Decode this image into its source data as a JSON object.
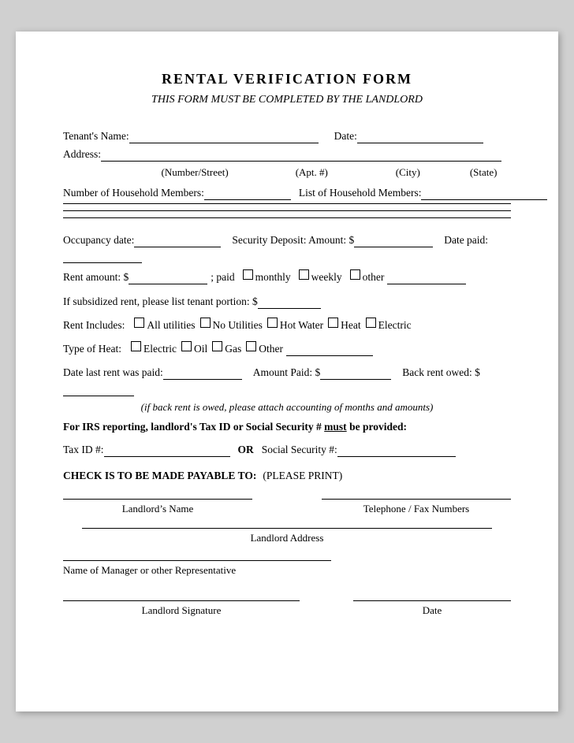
{
  "title": "RENTAL VERIFICATION FORM",
  "subtitle": "THIS FORM MUST BE COMPLETED BY THE LANDLORD",
  "fields": {
    "tenants_name_label": "Tenant's Name:",
    "date_label": "Date:",
    "address_label": "Address:",
    "number_street_label": "(Number/Street)",
    "apt_label": "(Apt. #)",
    "city_label": "(City)",
    "state_label": "(State)",
    "household_members_label": "Number of Household Members:",
    "list_household_label": "List of Household Members:",
    "occupancy_date_label": "Occupancy date:",
    "security_deposit_label": "Security Deposit: Amount: $",
    "date_paid_label": "Date paid:",
    "rent_amount_label": "Rent amount: $",
    "paid_label": "; paid",
    "monthly_label": "monthly",
    "weekly_label": "weekly",
    "other_label": "other",
    "subsidized_label": "If subsidized rent, please list tenant portion: $",
    "rent_includes_label": "Rent Includes:",
    "all_utilities_label": "All utilities",
    "no_utilities_label": "No Utilities",
    "hot_water_label": "Hot Water",
    "heat_label": "Heat",
    "electric_label": "Electric",
    "type_of_heat_label": "Type of Heat:",
    "electric_heat_label": "Electric",
    "oil_label": "Oil",
    "gas_label": "Gas",
    "other_heat_label": "Other",
    "date_last_rent_label": "Date last rent was paid:",
    "amount_paid_label": "Amount Paid: $",
    "back_rent_label": "Back rent owed: $",
    "back_rent_note": "(if back rent is owed, please attach accounting of months and amounts)",
    "irs_section_label": "For IRS reporting, landlord’s Tax ID or Social Security # must be provided:",
    "irs_must_label": "must",
    "tax_id_label": "Tax ID #:",
    "or_label": "OR",
    "social_security_label": "Social Security #:",
    "check_payable_label": "CHECK IS TO BE MADE PAYABLE TO:",
    "please_print_label": "(PLEASE PRINT)",
    "landlords_name_sig_label": "Landlord’s Name",
    "telephone_fax_label": "Telephone / Fax Numbers",
    "landlord_address_label": "Landlord Address",
    "manager_rep_label": "Name of Manager or other Representative",
    "landlord_signature_label": "Landlord Signature",
    "date_sig_label": "Date"
  }
}
